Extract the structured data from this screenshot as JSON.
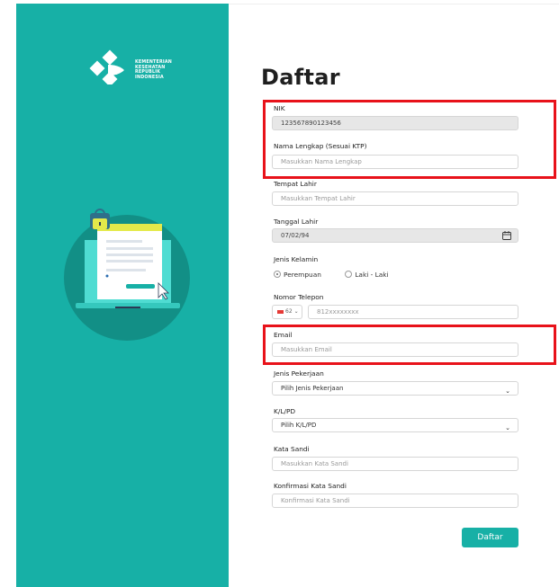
{
  "brand": {
    "logo_lines": [
      "KEMENTERIAN",
      "KESEHATAN",
      "REPUBLIK",
      "INDONESIA"
    ],
    "accent": "#17b0a6",
    "highlight": "#e8121a"
  },
  "form": {
    "title": "Daftar",
    "nik": {
      "label": "NIK",
      "value": "123567890123456"
    },
    "nama": {
      "label": "Nama Lengkap (Sesuai KTP)",
      "placeholder": "Masukkan Nama Lengkap"
    },
    "tempat_lahir": {
      "label": "Tempat Lahir",
      "placeholder": "Masukkan Tempat Lahir"
    },
    "tanggal_lahir": {
      "label": "Tanggal Lahir",
      "value": "07/02/94"
    },
    "jenis_kelamin": {
      "label": "Jenis Kelamin",
      "options": [
        "Perempuan",
        "Laki - Laki"
      ],
      "selected": "Perempuan"
    },
    "telepon": {
      "label": "Nomor Telepon",
      "country_code": "62",
      "value": "812xxxxxxxx"
    },
    "email": {
      "label": "Email",
      "placeholder": "Masukkan Email"
    },
    "pekerjaan": {
      "label": "Jenis Pekerjaan",
      "value": "Pilih Jenis Pekerjaan"
    },
    "klpd": {
      "label": "K/L/PD",
      "value": "Pilih K/L/PD"
    },
    "kata_sandi": {
      "label": "Kata Sandi",
      "placeholder": "Masukkan Kata Sandi"
    },
    "konfirmasi": {
      "label": "Konfirmasi Kata Sandi",
      "placeholder": "Konfirmasi Kata Sandi"
    },
    "submit_label": "Daftar"
  }
}
